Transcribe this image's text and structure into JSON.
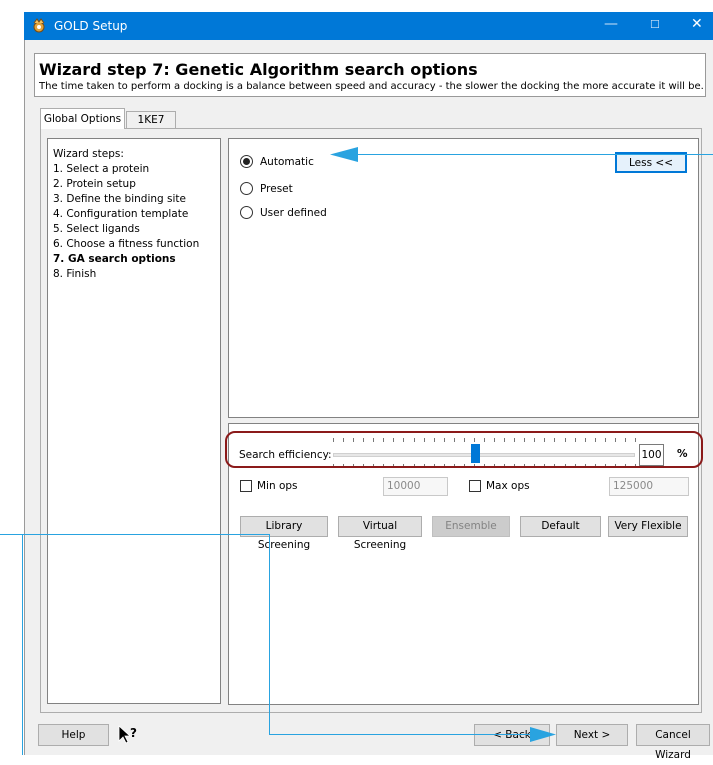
{
  "window": {
    "title": "GOLD Setup"
  },
  "header": {
    "title": "Wizard step 7: Genetic Algorithm search options",
    "subtitle": "The time taken to perform a docking is a balance between speed and accuracy - the slower the docking the more accurate it will be."
  },
  "tabs": [
    {
      "label": "Global Options",
      "active": true
    },
    {
      "label": "1KE7",
      "active": false
    }
  ],
  "steps": {
    "heading": "Wizard steps:",
    "items": [
      "1. Select a protein",
      "2. Protein setup",
      "3. Define the binding site",
      "4. Configuration template",
      "5. Select ligands",
      "6. Choose a fitness function",
      "7. GA search options",
      "8. Finish"
    ],
    "current_index": 6
  },
  "options": {
    "radios": [
      {
        "label": "Automatic",
        "selected": true
      },
      {
        "label": "Preset",
        "selected": false
      },
      {
        "label": "User defined",
        "selected": false
      }
    ],
    "less_button": "Less <<"
  },
  "efficiency": {
    "label": "Search efficiency:",
    "value": "100",
    "unit": "%",
    "slider_fraction": 0.47
  },
  "ops": {
    "min_label": "Min ops",
    "min_value": "10000",
    "max_label": "Max ops",
    "max_value": "125000"
  },
  "presets": {
    "library": "Library Screening",
    "virtual": "Virtual Screening",
    "ensemble": "Ensemble",
    "default": "Default",
    "flexible": "Very Flexible"
  },
  "footer": {
    "help": "Help",
    "back": "< Back",
    "next": "Next >",
    "cancel": "Cancel Wizard"
  },
  "colors": {
    "titlebar": "#0078d7",
    "highlight": "#8b1a1a",
    "annotation": "#29a3e0",
    "accent": "#0078d7"
  }
}
